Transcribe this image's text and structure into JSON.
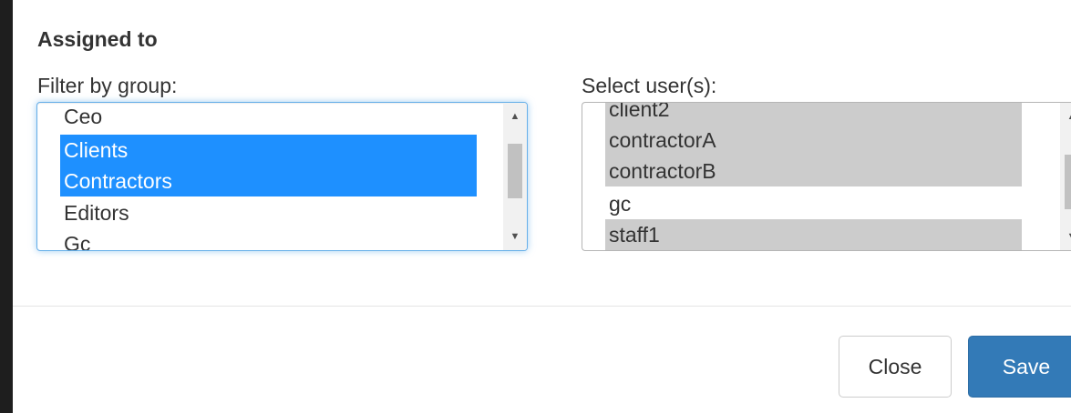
{
  "section": {
    "title": "Assigned to"
  },
  "group_filter": {
    "label": "Filter by group:",
    "options": [
      {
        "label": "Ceo",
        "selected": false
      },
      {
        "label": "Clients",
        "selected": true
      },
      {
        "label": "Contractors",
        "selected": true
      },
      {
        "label": "Editors",
        "selected": false
      },
      {
        "label": "Gc",
        "selected": false
      }
    ]
  },
  "user_select": {
    "label": "Select user(s):",
    "options": [
      {
        "label": "client2",
        "selected": true
      },
      {
        "label": "contractorA",
        "selected": true
      },
      {
        "label": "contractorB",
        "selected": true
      },
      {
        "label": "gc",
        "selected": false
      },
      {
        "label": "staff1",
        "selected": true
      }
    ]
  },
  "footer": {
    "close_label": "Close",
    "save_label": "Save"
  },
  "colors": {
    "group_selected_bg": "#1e90ff",
    "user_selected_bg": "#cccccc",
    "primary_button": "#337ab7",
    "focus_border": "#66afe9"
  }
}
